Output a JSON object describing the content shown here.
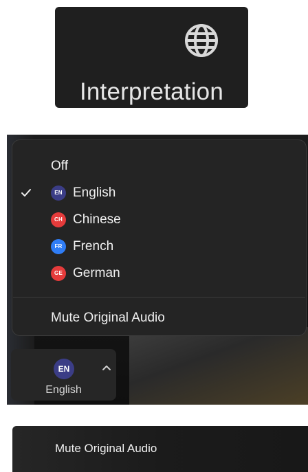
{
  "toolbar_button": {
    "icon": "globe-icon",
    "caret_icon": "chevron-up-icon",
    "label": "Interpretation"
  },
  "menu": {
    "items": [
      {
        "label": "Off",
        "checked": false
      },
      {
        "label": "English",
        "badge": "EN",
        "badge_color": "#3b3d86",
        "checked": true
      },
      {
        "label": "Chinese",
        "badge": "CH",
        "badge_color": "#e53b3b",
        "checked": false
      },
      {
        "label": "French",
        "badge": "FR",
        "badge_color": "#2f7df6",
        "checked": false
      },
      {
        "label": "German",
        "badge": "GE",
        "badge_color": "#e53b3b",
        "checked": false
      }
    ],
    "mute_label": "Mute Original Audio"
  },
  "language_button": {
    "badge": "EN",
    "badge_color": "#3b3d86",
    "caret_icon": "chevron-up-icon",
    "label": "English"
  },
  "bottom_strip": {
    "label": "Mute Original Audio"
  }
}
